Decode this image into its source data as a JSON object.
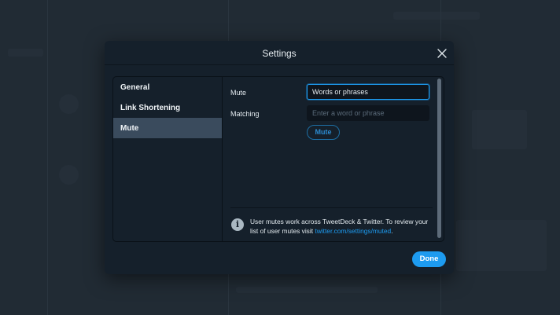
{
  "modal": {
    "title": "Settings",
    "close_icon": "close-icon",
    "done_label": "Done"
  },
  "sidebar": {
    "items": [
      {
        "label": "General",
        "active": false
      },
      {
        "label": "Link Shortening",
        "active": false
      },
      {
        "label": "Mute",
        "active": true
      }
    ]
  },
  "mute_form": {
    "mute_label": "Mute",
    "mute_value": "Words or phrases",
    "matching_label": "Matching",
    "matching_placeholder": "Enter a word or phrase",
    "mute_button_label": "Mute"
  },
  "info": {
    "icon": "info-icon",
    "text": "User mutes work across TweetDeck & Twitter. To review your list of user mutes visit ",
    "link_text": "twitter.com/settings/muted",
    "suffix": "."
  },
  "colors": {
    "accent": "#1d9bf0",
    "modal_bg": "#15202b",
    "active_nav": "#3a4b5d"
  }
}
